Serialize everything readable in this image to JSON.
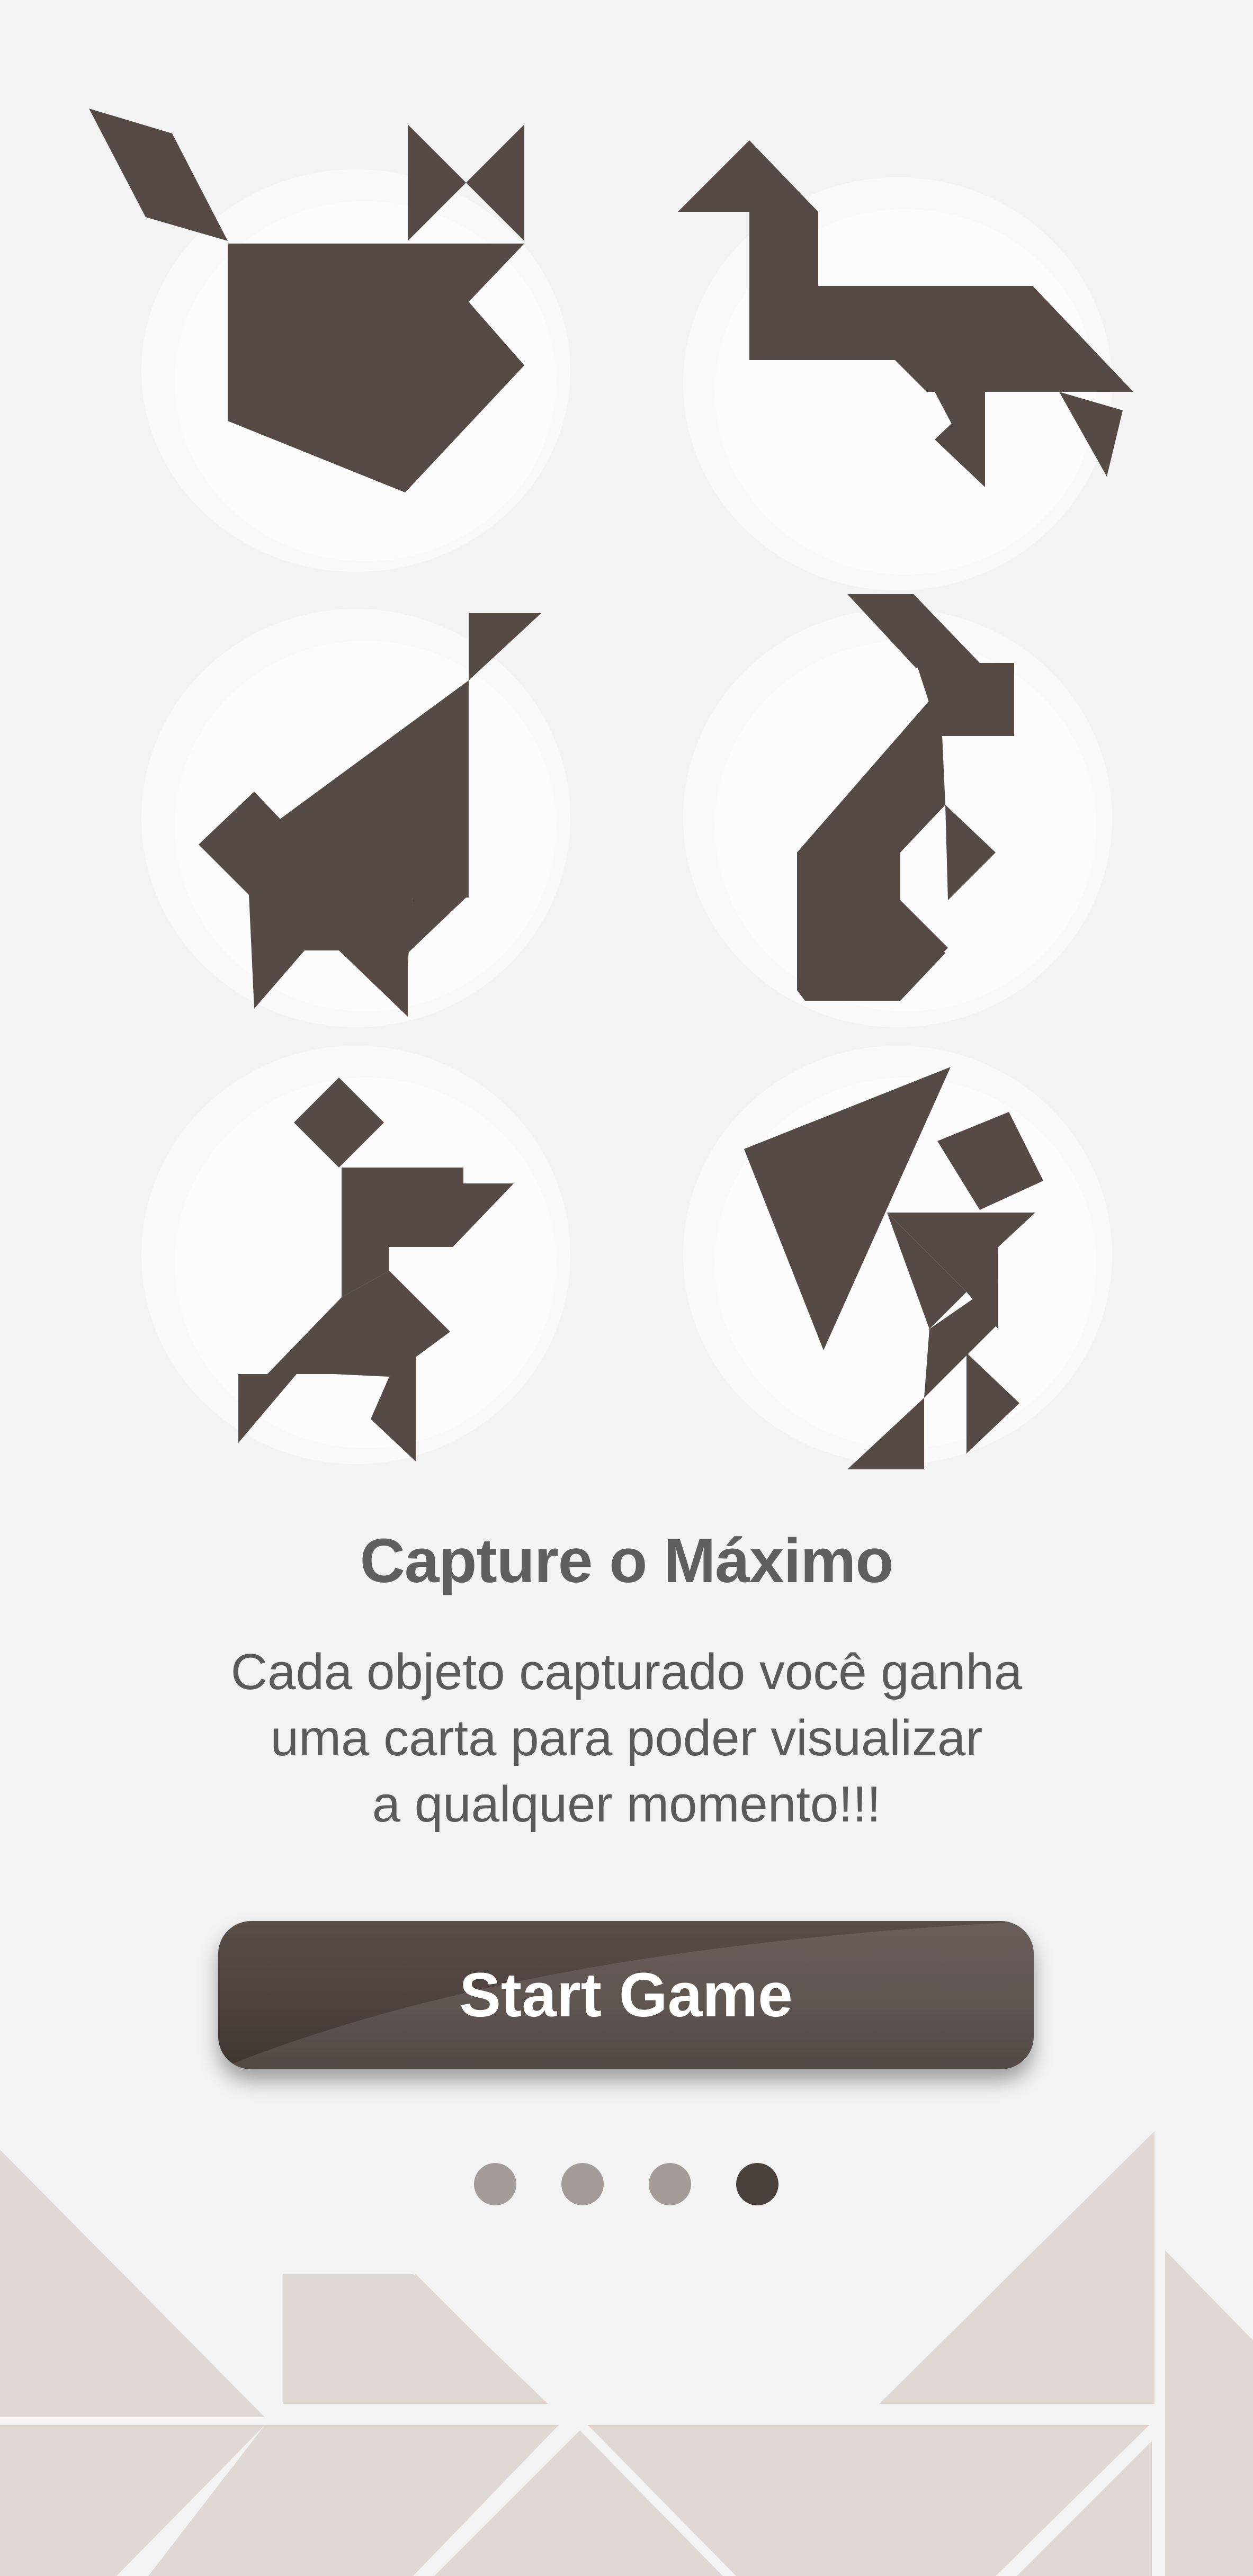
{
  "onboarding": {
    "title": "Capture o Máximo",
    "description_lines": [
      "Cada objeto capturado você ganha",
      "uma carta para poder visualizar",
      "a qualquer momento!!!"
    ],
    "start_button_label": "Start Game",
    "pager": {
      "total": 4,
      "current": 4
    }
  },
  "tangram_figures": [
    "fox-tangram-icon",
    "goose-tangram-icon",
    "cat-tangram-icon",
    "rabbit-tangram-icon",
    "runner-tangram-icon",
    "sailor-tangram-icon"
  ],
  "colors": {
    "background": "#f3f3f3",
    "tangram_piece": "#554a46",
    "title_text": "#5f5f5f",
    "body_text": "#5a5a5a",
    "button": "#4d423e",
    "button_text": "#ffffff",
    "dot_inactive": "#a39c98",
    "dot_active": "#4a403c",
    "decor_piece": "#dfd8d5"
  }
}
